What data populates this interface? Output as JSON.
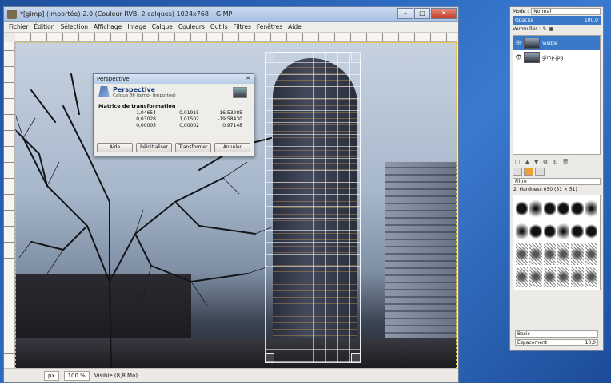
{
  "window": {
    "title": "*[gimp] (importée)-2.0 (Couleur RVB, 2 calques) 1024x768 – GIMP",
    "controls": [
      "–",
      "□",
      "✕"
    ]
  },
  "menu": [
    "Fichier",
    "Édition",
    "Sélection",
    "Affichage",
    "Image",
    "Calque",
    "Couleurs",
    "Outils",
    "Filtres",
    "Fenêtres",
    "Aide"
  ],
  "dialog": {
    "title": "Perspective",
    "heading": "Perspective",
    "subtitle": "Calque 86 (gimp) (importée)",
    "matrix_label": "Matrice de transformation",
    "matrix": [
      [
        "1,04654",
        "-0,01915",
        "-16,53285"
      ],
      [
        "0,03028",
        "1,01502",
        "-19,58430"
      ],
      [
        "0,00005",
        "0,00002",
        "0,97148"
      ]
    ],
    "buttons": {
      "help": "Aide",
      "reset": "Réinitialiser",
      "transform": "Transformer",
      "cancel": "Annuler"
    }
  },
  "status": {
    "unit": "px",
    "zoom": "100 %",
    "text": "Visible (8,8 Mo)"
  },
  "dock": {
    "mode_label": "Mode :",
    "mode_value": "Normal",
    "opacity_label": "Opacité",
    "opacity_value": "100,0",
    "lock_label": "Verrouiller :",
    "layers": [
      {
        "name": "Visible",
        "active": true
      },
      {
        "name": "gimp.jpg",
        "active": false
      }
    ],
    "brush_filter": "Filtre",
    "brush_name": "2. Hardness 050 (51 × 51)",
    "preset_label": "Basic",
    "spacing_label": "Espacement",
    "spacing_value": "10,0"
  }
}
